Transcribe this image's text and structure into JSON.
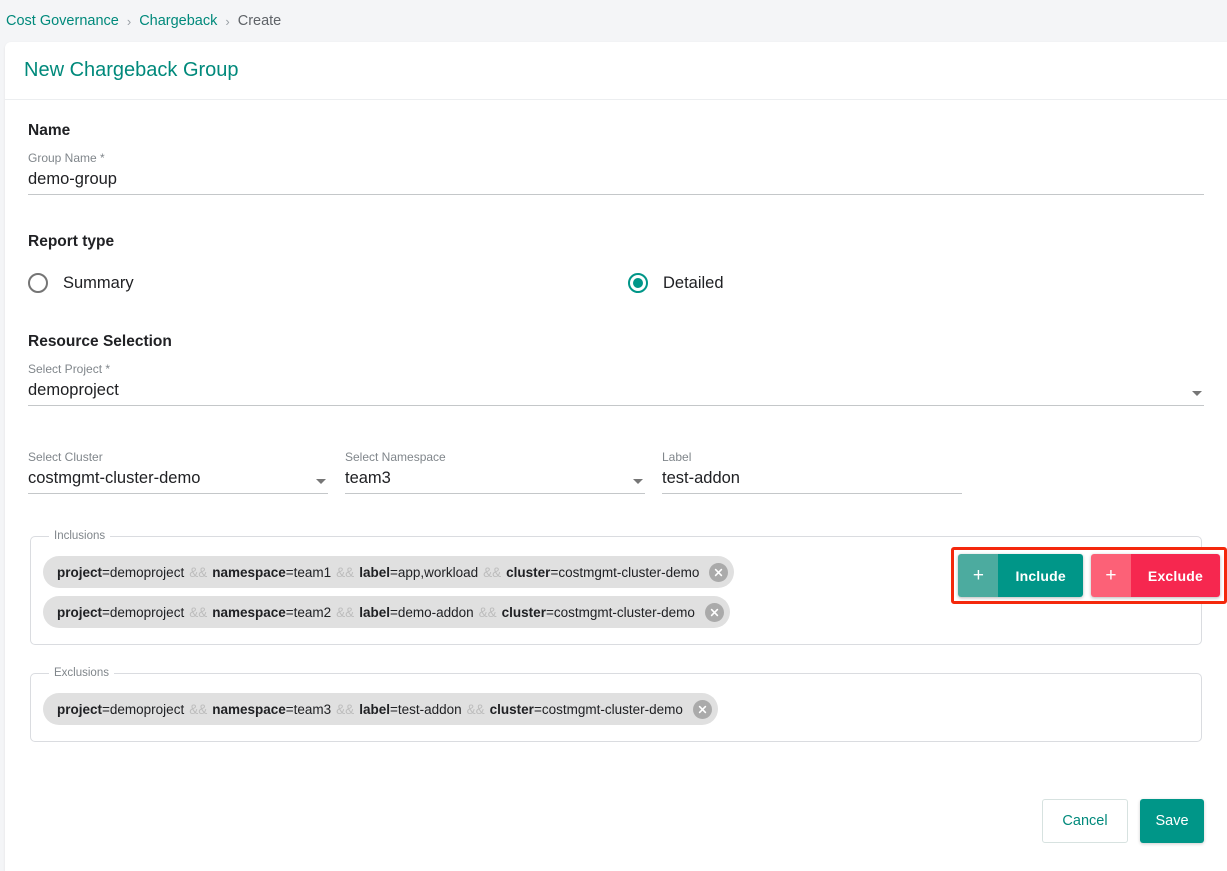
{
  "breadcrumb": {
    "items": [
      {
        "label": "Cost Governance",
        "current": false
      },
      {
        "label": "Chargeback",
        "current": false
      },
      {
        "label": "Create",
        "current": true
      }
    ],
    "separator": "›"
  },
  "card": {
    "title": "New Chargeback Group"
  },
  "name_section": {
    "heading": "Name",
    "group_name": {
      "label": "Group Name *",
      "value": "demo-group",
      "placeholder": "Group Name"
    }
  },
  "report_type": {
    "heading": "Report type",
    "options": [
      {
        "label": "Summary",
        "selected": false
      },
      {
        "label": "Detailed",
        "selected": true
      }
    ]
  },
  "resource_selection": {
    "heading": "Resource Selection",
    "project": {
      "label": "Select Project *",
      "value": "demoproject"
    },
    "cluster": {
      "label": "Select Cluster",
      "value": "costmgmt-cluster-demo"
    },
    "namespace": {
      "label": "Select Namespace",
      "value": "team3"
    },
    "label_field": {
      "label": "Label",
      "value": "test-addon"
    }
  },
  "action_buttons": {
    "highlighted": true,
    "highlight_color": "#f4280c",
    "include": {
      "plus": "+",
      "label": "Include",
      "plus_color": "#4cab9f",
      "color": "#009688"
    },
    "exclude": {
      "plus": "+",
      "label": "Exclude",
      "plus_color": "#fc6177",
      "color": "#f6274f"
    }
  },
  "inclusions": {
    "legend": "Inclusions",
    "chips": [
      {
        "parts": [
          {
            "key": "project",
            "value": "demoproject"
          },
          {
            "key": "namespace",
            "value": "team1"
          },
          {
            "key": "label",
            "value": "app,workload"
          },
          {
            "key": "cluster",
            "value": "costmgmt-cluster-demo"
          }
        ]
      },
      {
        "parts": [
          {
            "key": "project",
            "value": "demoproject"
          },
          {
            "key": "namespace",
            "value": "team2"
          },
          {
            "key": "label",
            "value": "demo-addon"
          },
          {
            "key": "cluster",
            "value": "costmgmt-cluster-demo"
          }
        ]
      }
    ]
  },
  "exclusions": {
    "legend": "Exclusions",
    "chips": [
      {
        "parts": [
          {
            "key": "project",
            "value": "demoproject"
          },
          {
            "key": "namespace",
            "value": "team3"
          },
          {
            "key": "label",
            "value": "test-addon"
          },
          {
            "key": "cluster",
            "value": "costmgmt-cluster-demo"
          }
        ]
      }
    ]
  },
  "chip_separator": "&&",
  "footer": {
    "cancel_label": "Cancel",
    "save_label": "Save"
  },
  "colors": {
    "accent": "#009688",
    "accent_text": "#00897b",
    "danger": "#f6274f",
    "page_bg": "#f4f5f7"
  }
}
